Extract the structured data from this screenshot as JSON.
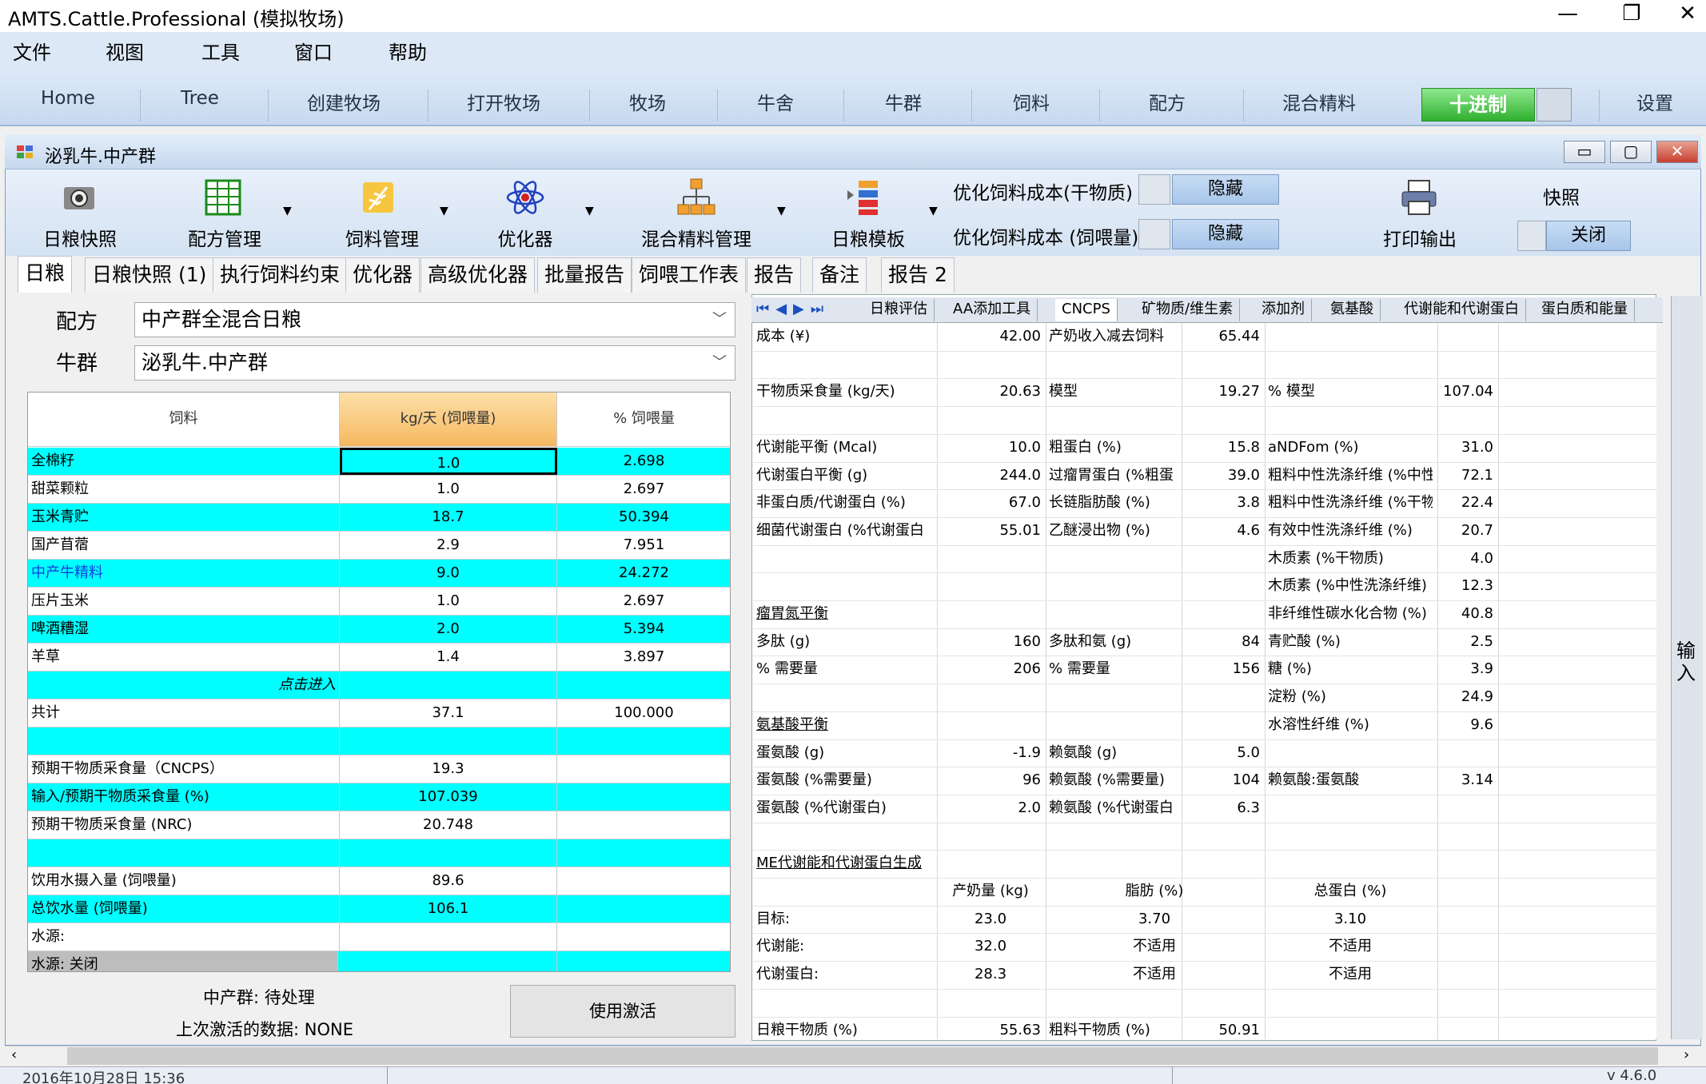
{
  "app": {
    "title": "AMTS.Cattle.Professional (模拟牧场)",
    "icon": "app-s-icon"
  },
  "menu": [
    "文件",
    "视图",
    "工具",
    "窗口",
    "帮助"
  ],
  "nav": [
    "Home",
    "Tree",
    "创建牧场",
    "打开牧场",
    "牧场",
    "牛舍",
    "牛群",
    "饲料",
    "配方",
    "混合精料",
    "十进制",
    "设置"
  ],
  "child": {
    "title": "泌乳牛.中产群"
  },
  "toolbar": {
    "snapshot": "日粮快照",
    "formula_mgmt": "配方管理",
    "feed_mgmt": "饲料管理",
    "optimizer": "优化器",
    "mix_mgmt": "混合精料管理",
    "template": "日粮模板",
    "opt_cost_dm": "优化饲料成本(干物质)",
    "opt_cost_fed": "优化饲料成本 (饲喂量)",
    "hide1": "隐藏",
    "hide2": "隐藏",
    "print": "打印输出",
    "quick": "快照",
    "close": "关闭"
  },
  "tabs": [
    "日粮",
    "日粮快照 (1)",
    "执行饲料约束",
    "优化器",
    "高级优化器",
    "批量报告",
    "饲喂工作表",
    "报告",
    "备注",
    "报告 2"
  ],
  "form": {
    "formula_label": "配方",
    "formula_value": "中产群全混合日粮",
    "herd_label": "牛群",
    "herd_value": "泌乳牛.中产群"
  },
  "grid": {
    "headers": [
      "饲料",
      "kg/天 (饲喂量)",
      "% 饲喂量"
    ],
    "rows": [
      {
        "name": "全棉籽",
        "kg": "1.0",
        "pct": "2.698",
        "cyan": true
      },
      {
        "name": "甜菜颗粒",
        "kg": "1.0",
        "pct": "2.697",
        "cyan": false
      },
      {
        "name": "玉米青贮",
        "kg": "18.7",
        "pct": "50.394",
        "cyan": true
      },
      {
        "name": "国产苜蓿",
        "kg": "2.9",
        "pct": "7.951",
        "cyan": false
      },
      {
        "name": "中产牛精料",
        "kg": "9.0",
        "pct": "24.272",
        "cyan": true
      },
      {
        "name": "压片玉米",
        "kg": "1.0",
        "pct": "2.697",
        "cyan": false
      },
      {
        "name": "啤酒糟湿",
        "kg": "2.0",
        "pct": "5.394",
        "cyan": true
      },
      {
        "name": "羊草",
        "kg": "1.4",
        "pct": "3.897",
        "cyan": false
      },
      {
        "name": "点击进入",
        "kg": "",
        "pct": "",
        "cyan": true
      },
      {
        "name": "共计",
        "kg": "37.1",
        "pct": "100.000",
        "cyan": false
      },
      {
        "name": "",
        "kg": "",
        "pct": "",
        "cyan": true
      },
      {
        "name": "预期干物质采食量（CNCPS）",
        "kg": "19.3",
        "pct": "",
        "cyan": false
      },
      {
        "name": "输入/预期干物质采食量 (%)",
        "kg": "107.039",
        "pct": "",
        "cyan": true
      },
      {
        "name": "预期干物质采食量 (NRC)",
        "kg": "20.748",
        "pct": "",
        "cyan": false
      },
      {
        "name": "",
        "kg": "",
        "pct": "",
        "cyan": true
      },
      {
        "name": "饮用水摄入量 (饲喂量)",
        "kg": "89.6",
        "pct": "",
        "cyan": false
      },
      {
        "name": "总饮水量 (饲喂量)",
        "kg": "106.1",
        "pct": "",
        "cyan": true
      },
      {
        "name": "水源:",
        "kg": "",
        "pct": "",
        "cyan": false
      },
      {
        "name": "水源: 关闭",
        "kg": "",
        "pct": "",
        "cyan": true
      }
    ]
  },
  "footer": {
    "status": "中产群: 待处理",
    "last": "上次激活的数据: NONE",
    "activate": "使用激活"
  },
  "rtabs": [
    "日粮评估",
    "AA添加工具",
    "CNCPS",
    "矿物质/维生素",
    "添加剂",
    "氨基酸",
    "代谢能和代谢蛋白",
    "蛋白质和能量"
  ],
  "rgrid": {
    "r0": [
      "成本 (¥)",
      "42.00",
      "产奶收入减去饲料",
      "65.44"
    ],
    "r2": [
      "干物质采食量 (kg/天)",
      "20.63",
      "模型",
      "19.27",
      "% 模型",
      "107.04"
    ],
    "r4": [
      "代谢能平衡 (Mcal)",
      "10.0",
      "粗蛋白 (%)",
      "15.8",
      "aNDFom (%)",
      "31.0"
    ],
    "r5": [
      "代谢蛋白平衡 (g)",
      "244.0",
      "过瘤胃蛋白 (%粗蛋",
      "39.0",
      "粗料中性洗涤纤维 (%中性",
      "72.1"
    ],
    "r6": [
      "非蛋白质/代谢蛋白 (%)",
      "67.0",
      "长链脂肪酸 (%)",
      "3.8",
      "粗料中性洗涤纤维 (%干物",
      "22.4"
    ],
    "r7": [
      "细菌代谢蛋白 (%代谢蛋白",
      "55.01",
      "乙醚浸出物 (%)",
      "4.6",
      "有效中性洗涤纤维 (%)",
      "20.7"
    ],
    "r8": [
      "木质素 (%干物质)",
      "4.0"
    ],
    "r9": [
      "木质素 (%中性洗涤纤维)",
      "12.3"
    ],
    "r10": [
      "瘤胃氮平衡",
      "非纤维性碳水化合物 (%)",
      "40.8"
    ],
    "r11": [
      "多肽 (g)",
      "160",
      "多肽和氨 (g)",
      "84",
      "青贮酸 (%)",
      "2.5"
    ],
    "r12": [
      "% 需要量",
      "206",
      "% 需要量",
      "156",
      "糖 (%)",
      "3.9"
    ],
    "r13": [
      "淀粉 (%)",
      "24.9"
    ],
    "r14": [
      "氨基酸平衡",
      "水溶性纤维 (%)",
      "9.6"
    ],
    "r15": [
      "蛋氨酸 (g)",
      "-1.9",
      "赖氨酸 (g)",
      "5.0"
    ],
    "r16": [
      "蛋氨酸 (%需要量)",
      "96",
      "赖氨酸 (%需要量)",
      "104",
      "赖氨酸:蛋氨酸",
      "3.14"
    ],
    "r17": [
      "蛋氨酸 (%代谢蛋白)",
      "2.0",
      "赖氨酸 (%代谢蛋白",
      "6.3"
    ],
    "r19": [
      "ME代谢能和代谢蛋白生成"
    ],
    "r20": [
      "产奶量 (kg)",
      "脂肪 (%)",
      "总蛋白 (%)"
    ],
    "r21": [
      "目标:",
      "23.0",
      "3.70",
      "3.10"
    ],
    "r22": [
      "代谢能:",
      "32.0",
      "不适用",
      "不适用"
    ],
    "r23": [
      "代谢蛋白:",
      "28.3",
      "不适用",
      "不适用"
    ],
    "r25": [
      "日粮干物质 (%)",
      "55.63",
      "粗料干物质 (%)",
      "50.91"
    ]
  },
  "side": "输入",
  "status": {
    "date": "2016年10月28日 15:36",
    "version": "v 4.6.0"
  }
}
